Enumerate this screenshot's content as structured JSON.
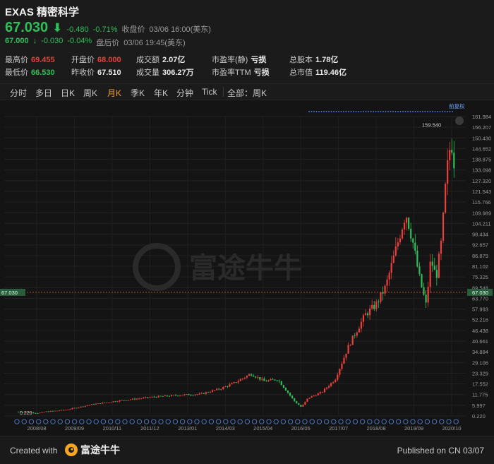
{
  "stock": {
    "title": "EXAS 精密科学",
    "price": "67.030",
    "change": "-0.480",
    "change_pct": "-0.71%",
    "close_label": "收盘价",
    "close_time": "03/06 16:00(美东)",
    "after_price": "67.000",
    "after_change": "-0.030",
    "after_change_pct": "-0.04%",
    "after_label": "盘后价",
    "after_time": "03/06 19:45(美东)"
  },
  "stats": [
    {
      "key": "最高价",
      "value": "69.455",
      "color": "#e8403d"
    },
    {
      "key": "开盘价",
      "value": "68.000",
      "color": "#e8403d"
    },
    {
      "key": "成交额",
      "value": "2.07亿",
      "color": "#e8e8e8"
    },
    {
      "key": "市盈率(静)",
      "value": "亏损",
      "color": "#e8e8e8"
    },
    {
      "key": "总股本",
      "value": "1.78亿",
      "color": "#e8e8e8"
    },
    {
      "key": "最低价",
      "value": "66.530",
      "color": "#2fbf5a"
    },
    {
      "key": "昨收价",
      "value": "67.510",
      "color": "#e8e8e8"
    },
    {
      "key": "成交量",
      "value": "306.27万",
      "color": "#e8e8e8"
    },
    {
      "key": "市盈率TTM",
      "value": "亏损",
      "color": "#e8e8e8"
    },
    {
      "key": "总市值",
      "value": "119.46亿",
      "color": "#e8e8e8"
    }
  ],
  "tabs": [
    {
      "label": "分时",
      "active": false
    },
    {
      "label": "多日",
      "active": false
    },
    {
      "label": "日K",
      "active": false
    },
    {
      "label": "周K",
      "active": false
    },
    {
      "label": "月K",
      "active": true
    },
    {
      "label": "季K",
      "active": false
    },
    {
      "label": "年K",
      "active": false
    },
    {
      "label": "分钟",
      "active": false
    },
    {
      "label": "Tick",
      "active": false
    }
  ],
  "range_label": "全部：周K",
  "chart_data": {
    "type": "candlestick",
    "adjust_label": "前复权",
    "watermark": "富途牛牛",
    "max_label": "159.540",
    "min_label": "0.220",
    "current_price": "67.030",
    "y_ticks": [
      "161.984",
      "156.207",
      "150.430",
      "144.652",
      "138.875",
      "133.098",
      "127.320",
      "121.543",
      "115.766",
      "109.989",
      "104.211",
      "98.434",
      "92.657",
      "86.879",
      "81.102",
      "75.325",
      "69.548",
      "63.770",
      "57.993",
      "52.216",
      "46.438",
      "40.661",
      "34.884",
      "29.106",
      "23.329",
      "17.552",
      "11.775",
      "5.997",
      "0.220"
    ],
    "x_labels": [
      "2008/08",
      "2009/09",
      "2010/11",
      "2011/12",
      "2013/01",
      "2014/03",
      "2015/04",
      "2016/05",
      "2017/07",
      "2018/08",
      "2019/09",
      "2020/10"
    ],
    "ylim": [
      0.22,
      161.984
    ],
    "colors": {
      "up": "#e8403d",
      "down": "#2fbf5a",
      "current_line": "#e8703a"
    }
  },
  "footer": {
    "created": "Created with",
    "brand": "富途牛牛",
    "published": "Published on CN 03/07"
  }
}
